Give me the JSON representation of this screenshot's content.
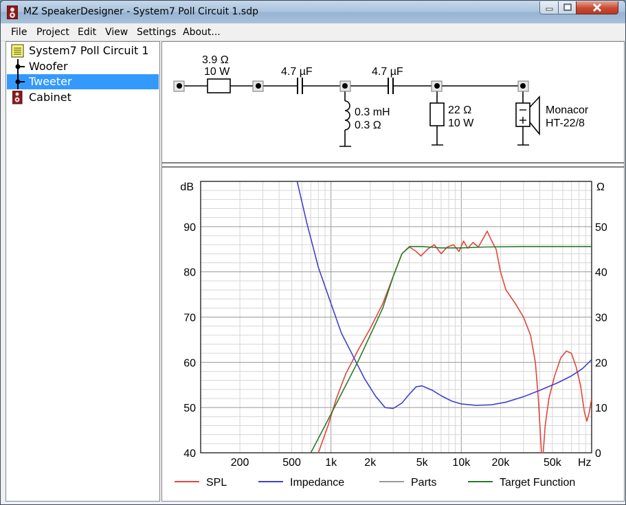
{
  "window": {
    "title": "MZ SpeakerDesigner - System7 Poll Circuit 1.sdp",
    "controls": {
      "minimize": "minimize",
      "maximize": "maximize",
      "close": "close"
    }
  },
  "menu": [
    "File",
    "Project",
    "Edit",
    "View",
    "Settings",
    "About..."
  ],
  "tree": {
    "root": "System7 Poll Circuit 1",
    "items": [
      {
        "label": "Woofer",
        "selected": false
      },
      {
        "label": "Tweeter",
        "selected": true
      },
      {
        "label": "Cabinet",
        "selected": false
      }
    ]
  },
  "circuit": {
    "resistor": {
      "value": "3.9 Ω",
      "power": "10 W"
    },
    "cap1": "4.7 µF",
    "cap2": "4.7 µF",
    "inductor": {
      "value": "0.3 mH",
      "resistance": "0.3 Ω"
    },
    "shunt_resistor": {
      "value": "22 Ω",
      "power": "10 W"
    },
    "driver": {
      "brand": "Monacor",
      "model": "HT-22/8"
    }
  },
  "chart_data": {
    "type": "line",
    "y_left_label": "dB",
    "y_right_label": "Ω",
    "x_unit_label": "Hz",
    "ylim_left": [
      40,
      100
    ],
    "ylim_right": [
      0,
      60
    ],
    "x_scale": "log",
    "xlim": [
      100,
      100000
    ],
    "y_left_ticks": [
      "90",
      "80",
      "70",
      "60",
      "50",
      "40"
    ],
    "y_right_ticks": [
      "50",
      "40",
      "30",
      "20",
      "10",
      "0"
    ],
    "x_ticks": [
      {
        "v": 200,
        "label": "200"
      },
      {
        "v": 500,
        "label": "500"
      },
      {
        "v": 1000,
        "label": "1k"
      },
      {
        "v": 2000,
        "label": "2k"
      },
      {
        "v": 5000,
        "label": "5k"
      },
      {
        "v": 10000,
        "label": "10k"
      },
      {
        "v": 20000,
        "label": "20k"
      },
      {
        "v": 50000,
        "label": "50k"
      }
    ],
    "grid": true,
    "legend": [
      {
        "name": "SPL",
        "color": "#e0453a"
      },
      {
        "name": "Impedance",
        "color": "#3f3fd0"
      },
      {
        "name": "Parts",
        "color": "#9a9a9a"
      },
      {
        "name": "Target Function",
        "color": "#2a7a2a"
      }
    ],
    "series": [
      {
        "name": "SPL",
        "axis": "left",
        "color": "#e0453a",
        "points": [
          [
            800,
            40
          ],
          [
            950,
            46
          ],
          [
            1100,
            52
          ],
          [
            1300,
            57.5
          ],
          [
            1600,
            62.5
          ],
          [
            2000,
            67.5
          ],
          [
            2500,
            73
          ],
          [
            3000,
            79
          ],
          [
            3500,
            84
          ],
          [
            4000,
            85.5
          ],
          [
            4500,
            84.5
          ],
          [
            4900,
            83.5
          ],
          [
            5500,
            85
          ],
          [
            6200,
            86
          ],
          [
            7000,
            84
          ],
          [
            7800,
            85.5
          ],
          [
            8700,
            86
          ],
          [
            9600,
            84.5
          ],
          [
            10400,
            86.8
          ],
          [
            11200,
            85.2
          ],
          [
            12300,
            86.5
          ],
          [
            13500,
            85.5
          ],
          [
            14800,
            87.5
          ],
          [
            15800,
            89
          ],
          [
            17000,
            87
          ],
          [
            18500,
            85
          ],
          [
            20000,
            80
          ],
          [
            22000,
            76
          ],
          [
            26000,
            73
          ],
          [
            30000,
            70
          ],
          [
            34000,
            66
          ],
          [
            37000,
            60
          ],
          [
            39000,
            52
          ],
          [
            40500,
            44
          ],
          [
            41200,
            40
          ],
          [
            42500,
            40
          ],
          [
            44000,
            46
          ],
          [
            47000,
            52
          ],
          [
            52000,
            57
          ],
          [
            58000,
            61
          ],
          [
            64000,
            62.5
          ],
          [
            70000,
            62
          ],
          [
            76000,
            59
          ],
          [
            82000,
            55
          ],
          [
            88000,
            49
          ],
          [
            92000,
            47
          ],
          [
            96000,
            49
          ],
          [
            100000,
            52
          ]
        ]
      },
      {
        "name": "Impedance",
        "axis": "right",
        "color": "#3f3fd0",
        "points": [
          [
            550,
            60
          ],
          [
            650,
            51
          ],
          [
            800,
            41
          ],
          [
            1000,
            33
          ],
          [
            1200,
            26.5
          ],
          [
            1500,
            21
          ],
          [
            1800,
            16.5
          ],
          [
            2200,
            12.5
          ],
          [
            2600,
            10
          ],
          [
            3000,
            9.8
          ],
          [
            3500,
            11
          ],
          [
            4000,
            13
          ],
          [
            4500,
            14.6
          ],
          [
            5000,
            14.8
          ],
          [
            6000,
            13.8
          ],
          [
            7000,
            12.6
          ],
          [
            8500,
            11.4
          ],
          [
            10000,
            10.8
          ],
          [
            13000,
            10.5
          ],
          [
            17000,
            10.6
          ],
          [
            22000,
            11.2
          ],
          [
            30000,
            12.4
          ],
          [
            40000,
            13.8
          ],
          [
            55000,
            15.5
          ],
          [
            70000,
            17
          ],
          [
            85000,
            18.6
          ],
          [
            100000,
            20.6
          ]
        ]
      },
      {
        "name": "Target Function",
        "axis": "left",
        "color": "#2a7a2a",
        "points": [
          [
            700,
            40
          ],
          [
            900,
            46
          ],
          [
            1200,
            53
          ],
          [
            1600,
            60
          ],
          [
            2000,
            66
          ],
          [
            2500,
            72
          ],
          [
            3000,
            79
          ],
          [
            3500,
            84
          ],
          [
            4000,
            85.6
          ],
          [
            5000,
            85.6
          ],
          [
            7000,
            85.3
          ],
          [
            10000,
            85.3
          ],
          [
            15000,
            85.5
          ],
          [
            30000,
            85.6
          ],
          [
            60000,
            85.6
          ],
          [
            100000,
            85.6
          ]
        ]
      }
    ]
  }
}
